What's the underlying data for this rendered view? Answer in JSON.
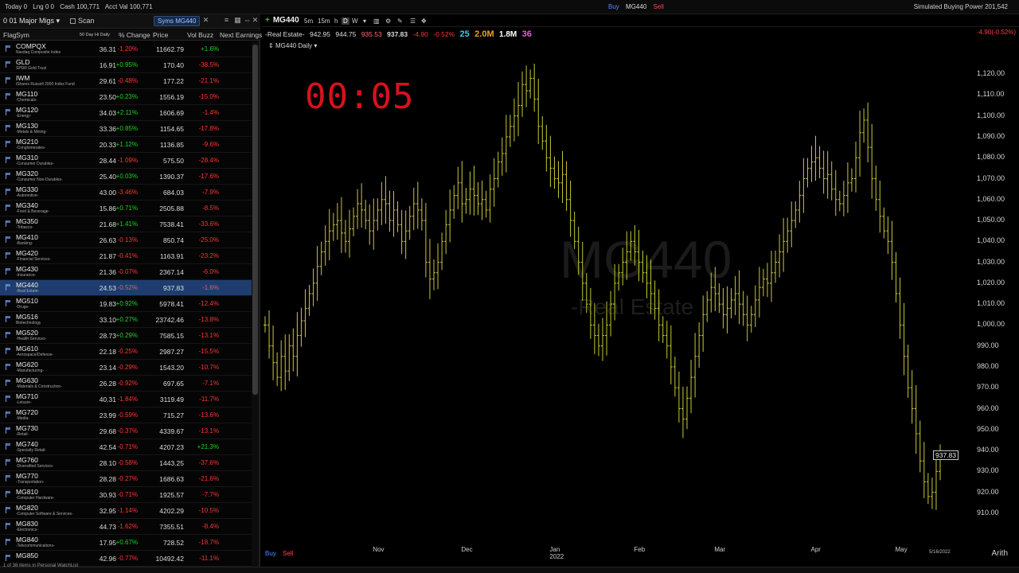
{
  "topbar": {
    "today": "Today 0",
    "lng": "Lng 0 0",
    "cash": "Cash 100,771",
    "acct": "Acct Val 100,771",
    "buy": "Buy",
    "symbol": "MG440",
    "sell": "Sell",
    "buying_power": "Simulated Buying Power 201,542"
  },
  "watchlist": {
    "title": "0 01 Major Migs",
    "scan": "Scan",
    "syms": "Syms  MG440",
    "columns": {
      "flag": "Flag",
      "sym": "Sym",
      "rs": "50 Day Hi Daily",
      "change": "% Change",
      "price": "Price",
      "vol_buzz": "Vol Buzz",
      "next_earnings": "Next Earnings"
    },
    "footer": "1 of 38 Items in Personal WatchList",
    "rows": [
      {
        "sym": "COMPQX",
        "sub": "Nasdaq Composite Index",
        "rs": "36.31",
        "chg": "-1.20%",
        "price": "11662.79",
        "vb": "+1.6%",
        "chg_dir": "dn",
        "vb_dir": "up"
      },
      {
        "sym": "GLD",
        "sub": "SPDR Gold Trust",
        "rs": "16.91",
        "chg": "+0.95%",
        "price": "170.40",
        "vb": "-38.5%",
        "chg_dir": "up",
        "vb_dir": "dn"
      },
      {
        "sym": "IWM",
        "sub": "iShares Russell 2000 Index Fund",
        "rs": "29.61",
        "chg": "-0.48%",
        "price": "177.22",
        "vb": "-21.1%",
        "chg_dir": "dn",
        "vb_dir": "dn"
      },
      {
        "sym": "MG110",
        "sub": "-Chemicals-",
        "rs": "23.50",
        "chg": "+0.23%",
        "price": "1556.19",
        "vb": "-15.0%",
        "chg_dir": "up",
        "vb_dir": "dn"
      },
      {
        "sym": "MG120",
        "sub": "-Energy-",
        "rs": "34.03",
        "chg": "+2.11%",
        "price": "1606.69",
        "vb": "-1.4%",
        "chg_dir": "up",
        "vb_dir": "dn"
      },
      {
        "sym": "MG130",
        "sub": "-Metals & Mining-",
        "rs": "33.36",
        "chg": "+0.85%",
        "price": "1154.65",
        "vb": "-17.8%",
        "chg_dir": "up",
        "vb_dir": "dn"
      },
      {
        "sym": "MG210",
        "sub": "-Conglomerates-",
        "rs": "20.33",
        "chg": "+1.12%",
        "price": "1136.85",
        "vb": "-9.6%",
        "chg_dir": "up",
        "vb_dir": "dn"
      },
      {
        "sym": "MG310",
        "sub": "-Consumer Durables-",
        "rs": "28.44",
        "chg": "-1.09%",
        "price": "575.50",
        "vb": "-28.4%",
        "chg_dir": "dn",
        "vb_dir": "dn"
      },
      {
        "sym": "MG320",
        "sub": "-Consumer Non-Durables-",
        "rs": "25.40",
        "chg": "+0.03%",
        "price": "1390.37",
        "vb": "-17.6%",
        "chg_dir": "up",
        "vb_dir": "dn"
      },
      {
        "sym": "MG330",
        "sub": "-Automotive-",
        "rs": "43.00",
        "chg": "-3.46%",
        "price": "684.03",
        "vb": "-7.9%",
        "chg_dir": "dn",
        "vb_dir": "dn"
      },
      {
        "sym": "MG340",
        "sub": "-Food & Beverage-",
        "rs": "15.86",
        "chg": "+0.71%",
        "price": "2505.88",
        "vb": "-8.5%",
        "chg_dir": "up",
        "vb_dir": "dn"
      },
      {
        "sym": "MG350",
        "sub": "-Tobacco-",
        "rs": "21.68",
        "chg": "+1.41%",
        "price": "7538.41",
        "vb": "-33.6%",
        "chg_dir": "up",
        "vb_dir": "dn"
      },
      {
        "sym": "MG410",
        "sub": "-Banking-",
        "rs": "26.63",
        "chg": "-0.13%",
        "price": "850.74",
        "vb": "-25.0%",
        "chg_dir": "dn",
        "vb_dir": "dn"
      },
      {
        "sym": "MG420",
        "sub": "-Financial Services-",
        "rs": "21.87",
        "chg": "-0.41%",
        "price": "1163.91",
        "vb": "-23.2%",
        "chg_dir": "dn",
        "vb_dir": "dn"
      },
      {
        "sym": "MG430",
        "sub": "-Insurance-",
        "rs": "21.36",
        "chg": "-0.07%",
        "price": "2367.14",
        "vb": "-6.0%",
        "chg_dir": "dn",
        "vb_dir": "dn"
      },
      {
        "sym": "MG440",
        "sub": "-Real Estate-",
        "rs": "24.53",
        "chg": "-0.52%",
        "price": "937.83",
        "vb": "-1.6%",
        "chg_dir": "dn",
        "vb_dir": "dn",
        "selected": true
      },
      {
        "sym": "MG510",
        "sub": "-Drugs-",
        "rs": "19.83",
        "chg": "+0.92%",
        "price": "5978.41",
        "vb": "-12.4%",
        "chg_dir": "up",
        "vb_dir": "dn"
      },
      {
        "sym": "MG516",
        "sub": "Biotechnology",
        "rs": "33.10",
        "chg": "+0.27%",
        "price": "23742.46",
        "vb": "-13.8%",
        "chg_dir": "up",
        "vb_dir": "dn"
      },
      {
        "sym": "MG520",
        "sub": "-Health Services-",
        "rs": "28.73",
        "chg": "+0.29%",
        "price": "7585.15",
        "vb": "-13.1%",
        "chg_dir": "up",
        "vb_dir": "dn"
      },
      {
        "sym": "MG610",
        "sub": "-Aerospace/Defense-",
        "rs": "22.18",
        "chg": "-0.25%",
        "price": "2987.27",
        "vb": "-15.5%",
        "chg_dir": "dn",
        "vb_dir": "dn"
      },
      {
        "sym": "MG620",
        "sub": "-Manufacturing-",
        "rs": "23.14",
        "chg": "-0.29%",
        "price": "1543.20",
        "vb": "-10.7%",
        "chg_dir": "dn",
        "vb_dir": "dn"
      },
      {
        "sym": "MG630",
        "sub": "-Materials & Construction-",
        "rs": "26.28",
        "chg": "-0.92%",
        "price": "697.65",
        "vb": "-7.1%",
        "chg_dir": "dn",
        "vb_dir": "dn"
      },
      {
        "sym": "MG710",
        "sub": "-Leisure-",
        "rs": "40.31",
        "chg": "-1.84%",
        "price": "3119.49",
        "vb": "-11.7%",
        "chg_dir": "dn",
        "vb_dir": "dn"
      },
      {
        "sym": "MG720",
        "sub": "-Media-",
        "rs": "23.99",
        "chg": "-0.59%",
        "price": "715.27",
        "vb": "-13.6%",
        "chg_dir": "dn",
        "vb_dir": "dn"
      },
      {
        "sym": "MG730",
        "sub": "-Retail-",
        "rs": "29.68",
        "chg": "-0.37%",
        "price": "4339.67",
        "vb": "-13.1%",
        "chg_dir": "dn",
        "vb_dir": "dn"
      },
      {
        "sym": "MG740",
        "sub": "-Specialty Retail-",
        "rs": "42.54",
        "chg": "-0.71%",
        "price": "4207.23",
        "vb": "+21.3%",
        "chg_dir": "dn",
        "vb_dir": "up"
      },
      {
        "sym": "MG760",
        "sub": "-Diversified Services-",
        "rs": "28.10",
        "chg": "-0.58%",
        "price": "1443.25",
        "vb": "-37.6%",
        "chg_dir": "dn",
        "vb_dir": "dn"
      },
      {
        "sym": "MG770",
        "sub": "-Transportation-",
        "rs": "28.28",
        "chg": "-0.27%",
        "price": "1686.63",
        "vb": "-21.6%",
        "chg_dir": "dn",
        "vb_dir": "dn"
      },
      {
        "sym": "MG810",
        "sub": "-Computer Hardware-",
        "rs": "30.93",
        "chg": "-0.71%",
        "price": "1925.57",
        "vb": "-7.7%",
        "chg_dir": "dn",
        "vb_dir": "dn"
      },
      {
        "sym": "MG820",
        "sub": "-Computer Software & Services-",
        "rs": "32.95",
        "chg": "-1.14%",
        "price": "4202.29",
        "vb": "-10.5%",
        "chg_dir": "dn",
        "vb_dir": "dn"
      },
      {
        "sym": "MG830",
        "sub": "-Electronics-",
        "rs": "44.73",
        "chg": "-1.62%",
        "price": "7355.51",
        "vb": "-8.4%",
        "chg_dir": "dn",
        "vb_dir": "dn"
      },
      {
        "sym": "MG840",
        "sub": "-Telecommunications-",
        "rs": "17.95",
        "chg": "+0.67%",
        "price": "728.52",
        "vb": "-18.7%",
        "chg_dir": "up",
        "vb_dir": "dn"
      },
      {
        "sym": "MG850",
        "sub": "",
        "rs": "42.96",
        "chg": "-0.77%",
        "price": "10492.42",
        "vb": "-11.1%",
        "chg_dir": "dn",
        "vb_dir": "dn"
      }
    ]
  },
  "chart": {
    "symbol": "MG440",
    "timeframes": [
      "5m",
      "15m",
      "h",
      "D",
      "W"
    ],
    "active_timeframe": "D",
    "quote": {
      "industry": "-Real Estate-",
      "open": "942.95",
      "high": "944.75",
      "low": "935.53",
      "last": "937.83",
      "change": "-4.90",
      "change_pct": "-0.52%",
      "rank": "25",
      "vol": "2.0M",
      "avg_vol": "1.8M",
      "rs": "36"
    },
    "interval_label": "MG440 Daily",
    "timer": "00:05",
    "watermark_symbol": "MG440",
    "watermark_industry": "-Real Estate",
    "last_price_tag": "937.83",
    "right_change": "-4.90(-0.52%)",
    "buy": "Buy",
    "sell": "Sell",
    "arith": "Arith",
    "date_label": "5/16/2022",
    "bar_color": "#c8c832",
    "chart_data": {
      "type": "ohlc-bar",
      "y_range": [
        905,
        1125
      ],
      "y_ticks": [
        "1,120.00",
        "1,110.00",
        "1,100.00",
        "1,090.00",
        "1,080.00",
        "1,070.00",
        "1,060.00",
        "1,050.00",
        "1,040.00",
        "1,030.00",
        "1,020.00",
        "1,010.00",
        "1,000.00",
        "990.00",
        "980.00",
        "970.00",
        "960.00",
        "950.00",
        "940.00",
        "930.00",
        "920.00",
        "910.00"
      ],
      "x_labels": [
        {
          "label": "Nov",
          "index": 28
        },
        {
          "label": "Dec",
          "index": 50
        },
        {
          "label": "Jan",
          "index": 72,
          "sub": "2022"
        },
        {
          "label": "Feb",
          "index": 93
        },
        {
          "label": "Mar",
          "index": 113
        },
        {
          "label": "Apr",
          "index": 137
        },
        {
          "label": "May",
          "index": 158
        }
      ],
      "closes": [
        1000,
        990,
        982,
        975,
        985,
        978,
        990,
        985,
        995,
        1002,
        1008,
        1015,
        1020,
        1028,
        1035,
        1040,
        1045,
        1048,
        1050,
        1044,
        1040,
        1046,
        1052,
        1058,
        1055,
        1050,
        1045,
        1050,
        1055,
        1060,
        1058,
        1050,
        1055,
        1048,
        1040,
        1045,
        1052,
        1058,
        1055,
        1050,
        1030,
        1022,
        1025,
        1030,
        1040,
        1048,
        1055,
        1062,
        1068,
        1058,
        1060,
        1065,
        1062,
        1058,
        1060,
        1055,
        1065,
        1070,
        1078,
        1082,
        1090,
        1095,
        1100,
        1105,
        1115,
        1112,
        1118,
        1108,
        1095,
        1088,
        1080,
        1075,
        1070,
        1068,
        1072,
        1060,
        1050,
        1040,
        1030,
        1020,
        1010,
        1000,
        995,
        990,
        995,
        1000,
        1010,
        1020,
        1025,
        1030,
        1035,
        1040,
        1035,
        1030,
        1025,
        1020,
        1015,
        1008,
        1000,
        995,
        990,
        980,
        970,
        960,
        955,
        965,
        975,
        985,
        995,
        1005,
        1012,
        1018,
        1015,
        1010,
        1005,
        1008,
        1012,
        1015,
        1010,
        1005,
        1000,
        1005,
        1012,
        1018,
        1022,
        1020,
        1025,
        1030,
        1035,
        1040,
        1045,
        1050,
        1055,
        1062,
        1070,
        1075,
        1078,
        1080,
        1075,
        1070,
        1072,
        1065,
        1060,
        1058,
        1062,
        1068,
        1070,
        1080,
        1092,
        1098,
        1085,
        1070,
        1060,
        1052,
        1045,
        1040,
        1030,
        1015,
        1000,
        985,
        970,
        960,
        948,
        935,
        925,
        918,
        920,
        930,
        938
      ]
    }
  }
}
